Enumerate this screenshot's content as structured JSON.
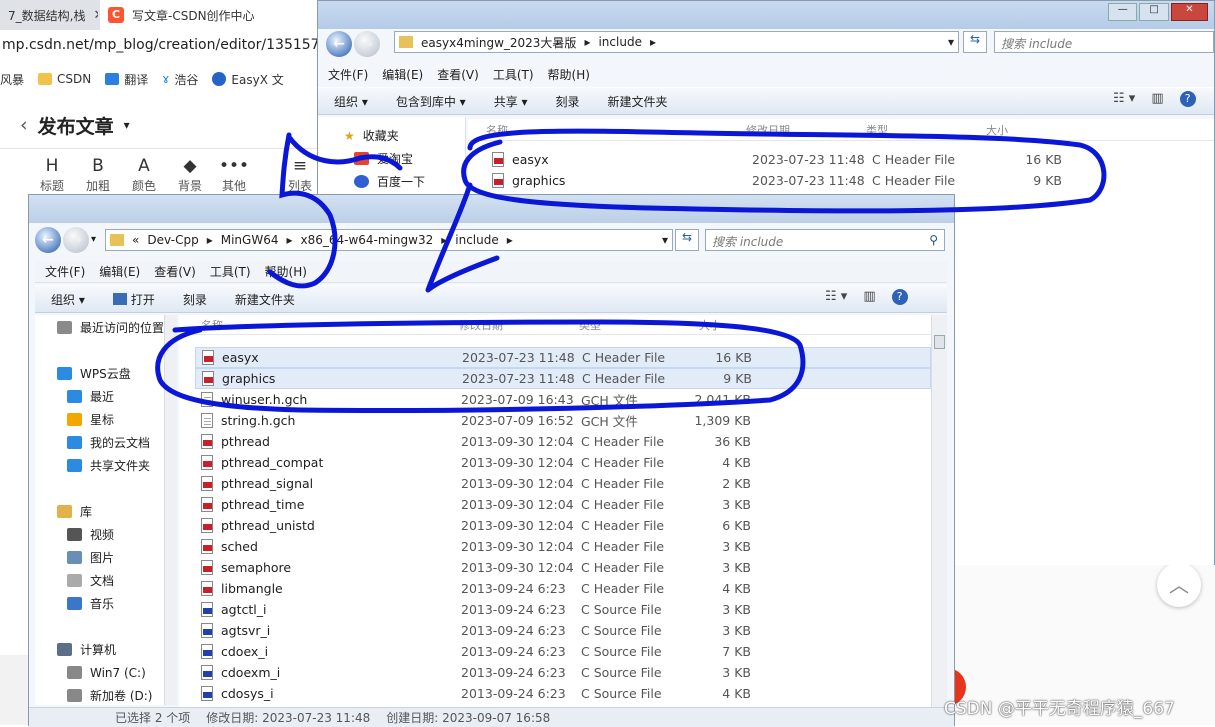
{
  "browser": {
    "tabs": [
      {
        "label": "7_数据结构,栈"
      },
      {
        "label": "写文章-CSDN创作中心"
      }
    ],
    "tab_close": "✕",
    "address": "mp.csdn.net/mp_blog/creation/editor/13515770",
    "bookmarks": [
      "风暴",
      "CSDN",
      "翻译",
      "浩谷",
      "EasyX 文"
    ],
    "editor_title": "发布文章",
    "toolbar": [
      {
        "label": "标题",
        "glyph": "H"
      },
      {
        "label": "加粗",
        "glyph": "B"
      },
      {
        "label": "颜色",
        "glyph": "A"
      },
      {
        "label": "背景",
        "glyph": "◆"
      },
      {
        "label": "其他",
        "glyph": "•••"
      },
      {
        "label": "列表",
        "glyph": "≡"
      }
    ],
    "watermark": "CSDN @平平无奇程序猿_667"
  },
  "explorer_back": {
    "path": [
      "easyx4mingw_2023大暑版",
      "include"
    ],
    "search_placeholder": "搜索 include",
    "menu": [
      "文件(F)",
      "编辑(E)",
      "查看(V)",
      "工具(T)",
      "帮助(H)"
    ],
    "commands": [
      "组织 ▾",
      "包含到库中 ▾",
      "共享 ▾",
      "刻录",
      "新建文件夹"
    ],
    "columns": [
      "名称",
      "修改日期",
      "类型",
      "大小"
    ],
    "nav": [
      "收藏夹",
      "爱淘宝",
      "百度一下"
    ],
    "files": [
      {
        "name": "easyx",
        "date": "2023-07-23 11:48",
        "type": "C Header File",
        "size": "16 KB",
        "icon": "h"
      },
      {
        "name": "graphics",
        "date": "2023-07-23 11:48",
        "type": "C Header File",
        "size": "9 KB",
        "icon": "h"
      }
    ]
  },
  "explorer_front": {
    "path": [
      "«",
      "Dev-Cpp",
      "MinGW64",
      "x86_64-w64-mingw32",
      "include"
    ],
    "search_placeholder": "搜索 include",
    "menu": [
      "文件(F)",
      "编辑(E)",
      "查看(V)",
      "工具(T)",
      "帮助(H)"
    ],
    "commands": [
      "组织 ▾",
      "打开",
      "刻录",
      "新建文件夹"
    ],
    "columns": [
      "名称",
      "修改日期",
      "类型",
      "大小"
    ],
    "nav": [
      {
        "label": "最近访问的位置",
        "color": "#8a8a8a"
      },
      {
        "label": "",
        "color": ""
      },
      {
        "label": "WPS云盘",
        "color": "#2a8be0"
      },
      {
        "label": "最近",
        "color": "#2a8be0"
      },
      {
        "label": "星标",
        "color": "#f0a800"
      },
      {
        "label": "我的云文档",
        "color": "#2a8be0"
      },
      {
        "label": "共享文件夹",
        "color": "#2a8be0"
      },
      {
        "label": "",
        "color": ""
      },
      {
        "label": "库",
        "color": "#e2b14a"
      },
      {
        "label": "视频",
        "color": "#555"
      },
      {
        "label": "图片",
        "color": "#6a8fb7"
      },
      {
        "label": "文档",
        "color": "#aaa"
      },
      {
        "label": "音乐",
        "color": "#3b76c8"
      },
      {
        "label": "",
        "color": ""
      },
      {
        "label": "计算机",
        "color": "#5b6f88"
      },
      {
        "label": "Win7 (C:)",
        "color": "#888"
      },
      {
        "label": "新加卷 (D:)",
        "color": "#888"
      }
    ],
    "files": [
      {
        "name": "easyx",
        "date": "2023-07-23 11:48",
        "type": "C Header File",
        "size": "16 KB",
        "icon": "h",
        "sel": true
      },
      {
        "name": "graphics",
        "date": "2023-07-23 11:48",
        "type": "C Header File",
        "size": "9 KB",
        "icon": "h",
        "sel": true
      },
      {
        "name": "winuser.h.gch",
        "date": "2023-07-09 16:43",
        "type": "GCH 文件",
        "size": "2,041 KB",
        "icon": "g",
        "sel": false
      },
      {
        "name": "string.h.gch",
        "date": "2023-07-09 16:52",
        "type": "GCH 文件",
        "size": "1,309 KB",
        "icon": "g",
        "sel": false
      },
      {
        "name": "pthread",
        "date": "2013-09-30 12:04",
        "type": "C Header File",
        "size": "36 KB",
        "icon": "h",
        "sel": false
      },
      {
        "name": "pthread_compat",
        "date": "2013-09-30 12:04",
        "type": "C Header File",
        "size": "4 KB",
        "icon": "h",
        "sel": false
      },
      {
        "name": "pthread_signal",
        "date": "2013-09-30 12:04",
        "type": "C Header File",
        "size": "2 KB",
        "icon": "h",
        "sel": false
      },
      {
        "name": "pthread_time",
        "date": "2013-09-30 12:04",
        "type": "C Header File",
        "size": "3 KB",
        "icon": "h",
        "sel": false
      },
      {
        "name": "pthread_unistd",
        "date": "2013-09-30 12:04",
        "type": "C Header File",
        "size": "6 KB",
        "icon": "h",
        "sel": false
      },
      {
        "name": "sched",
        "date": "2013-09-30 12:04",
        "type": "C Header File",
        "size": "3 KB",
        "icon": "h",
        "sel": false
      },
      {
        "name": "semaphore",
        "date": "2013-09-30 12:04",
        "type": "C Header File",
        "size": "3 KB",
        "icon": "h",
        "sel": false
      },
      {
        "name": "libmangle",
        "date": "2013-09-24 6:23",
        "type": "C Header File",
        "size": "4 KB",
        "icon": "h",
        "sel": false
      },
      {
        "name": "agtctl_i",
        "date": "2013-09-24 6:23",
        "type": "C Source File",
        "size": "3 KB",
        "icon": "c",
        "sel": false
      },
      {
        "name": "agtsvr_i",
        "date": "2013-09-24 6:23",
        "type": "C Source File",
        "size": "3 KB",
        "icon": "c",
        "sel": false
      },
      {
        "name": "cdoex_i",
        "date": "2013-09-24 6:23",
        "type": "C Source File",
        "size": "7 KB",
        "icon": "c",
        "sel": false
      },
      {
        "name": "cdoexm_i",
        "date": "2013-09-24 6:23",
        "type": "C Source File",
        "size": "3 KB",
        "icon": "c",
        "sel": false
      },
      {
        "name": "cdosys_i",
        "date": "2013-09-24 6:23",
        "type": "C Source File",
        "size": "4 KB",
        "icon": "c",
        "sel": false
      }
    ],
    "status": {
      "selected": "已选择 2 个项",
      "modified": "修改日期: 2023-07-23 11:48",
      "created": "创建日期: 2023-09-07 16:58"
    }
  },
  "colors": {
    "annotation": "#0a17d6"
  }
}
